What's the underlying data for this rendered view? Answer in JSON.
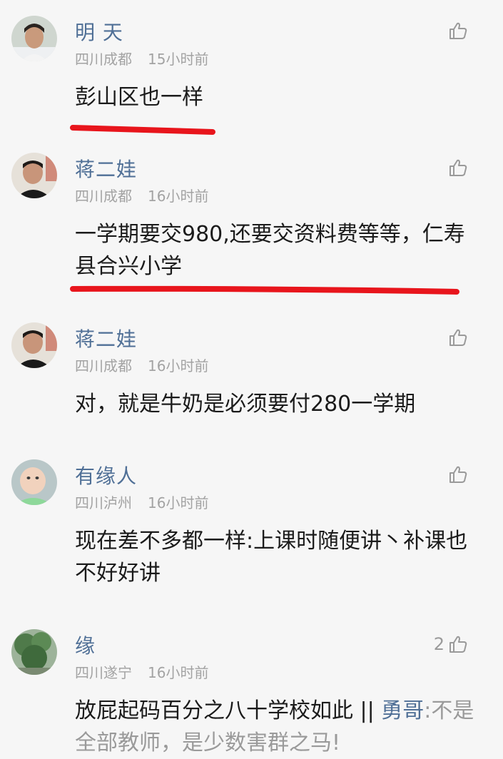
{
  "comments": [
    {
      "username": "明 天",
      "location": "四川成都",
      "time": "15小时前",
      "likes": "",
      "text": "彭山区也一样",
      "avatar": "person-avatar"
    },
    {
      "username": "蒋二娃",
      "location": "四川成都",
      "time": "16小时前",
      "likes": "",
      "text": "一学期要交980,还要交资料费等等，仁寿县合兴小学",
      "avatar": "person-avatar"
    },
    {
      "username": "蒋二娃",
      "location": "四川成都",
      "time": "16小时前",
      "likes": "",
      "text": "对，就是牛奶是必须要付280一学期",
      "avatar": "person-avatar"
    },
    {
      "username": "有缘人",
      "location": "四川泸州",
      "time": "16小时前",
      "likes": "",
      "text": "现在差不多都一样:上课时随便讲丶补课也不好好讲",
      "avatar": "baby-avatar"
    },
    {
      "username": "缘",
      "location": "四川遂宁",
      "time": "16小时前",
      "likes": "2",
      "text": "放屁起码百分之八十学校如此",
      "reply_sep": " || ",
      "reply_name": "勇哥",
      "reply_text": ":不是全部教师，是少数害群之马!",
      "avatar": "tree-avatar"
    }
  ],
  "colors": {
    "username": "#4f6f96",
    "meta": "#a3a3a3",
    "underline": "#e8151c",
    "background": "#f6f6f6"
  },
  "icons": {
    "like": "thumbs-up-icon"
  }
}
